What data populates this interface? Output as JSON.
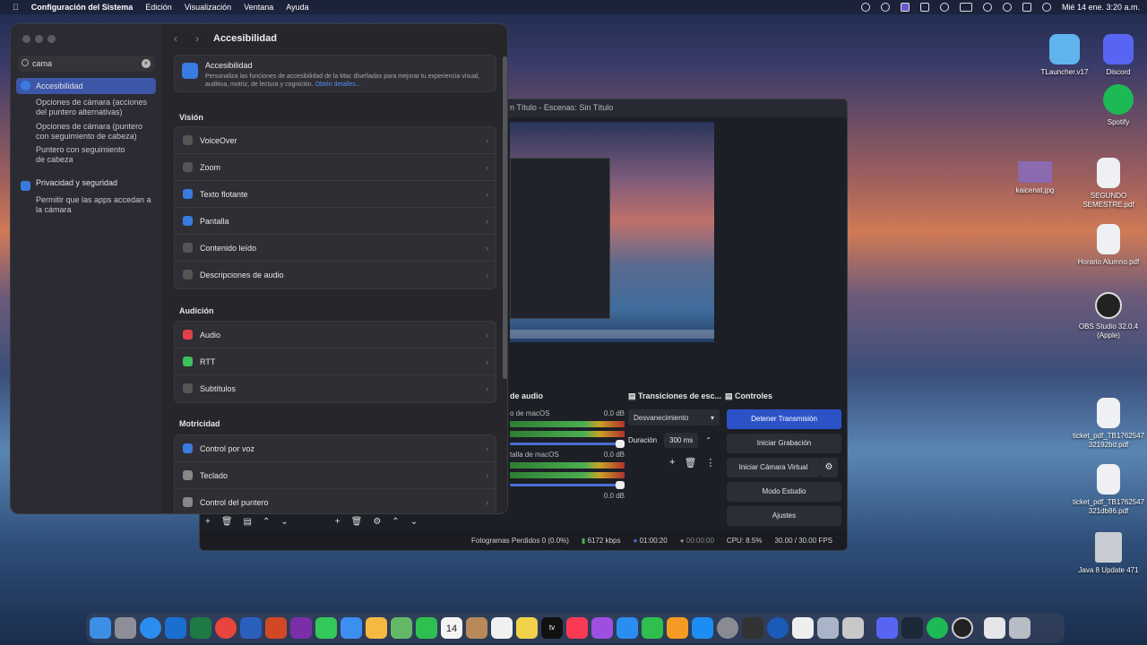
{
  "menubar": {
    "apple": "",
    "app": "Configuración del Sistema",
    "items": [
      "Edición",
      "Visualización",
      "Ventana",
      "Ayuda"
    ],
    "clock": "Mié 14 ene.  3:20 a.m."
  },
  "obs": {
    "title": "n Título - Escenas: Sin Título",
    "audio_header": "de audio",
    "audio_tracks": [
      {
        "name": "o de macOS",
        "db": "0.0 dB"
      },
      {
        "name": "talla de macOS",
        "db": "0.0 dB"
      }
    ],
    "last_db": "0.0 dB",
    "transitions_header": "Transiciones de esc...",
    "transition_value": "Desvanecimiento",
    "duration_label": "Duración",
    "duration_value": "300 ms",
    "controls_header": "Controles",
    "buttons": [
      "Detener Transmisión",
      "Iniciar Grabación",
      "Iniciar Cámara Virtual",
      "Modo Estudio",
      "Ajustes"
    ],
    "status": {
      "dropped": "Fotogramas Perdidos 0 (0.0%)",
      "bitrate": "6172 kbps",
      "stream_time": "01:00:20",
      "rec_time": "00:00:00",
      "cpu": "CPU: 8.5%",
      "fps": "30.00 / 30.00 FPS"
    }
  },
  "settings": {
    "search_value": "cama",
    "sidebar": {
      "acc": "Accesibilidad",
      "acc_subs": [
        "Opciones de cámara (acciones del puntero alternativas)",
        "Opciones de cámara (puntero con seguimiento de cabeza)",
        "Puntero con seguimiento de cabeza"
      ],
      "priv": "Privacidad y seguridad",
      "priv_subs": [
        "Permitir que las apps accedan a la cámara"
      ]
    },
    "title": "Accesibilidad",
    "intro_title": "Accesibilidad",
    "intro_text": "Personaliza las funciones de accesibilidad de la Mac diseñadas para mejorar tu experiencia visual, auditiva, motriz, de lectura y cognición.",
    "intro_link": "Obtén detalles...",
    "vision_header": "Visión",
    "vision": [
      "VoiceOver",
      "Zoom",
      "Texto flotante",
      "Pantalla",
      "Contenido leído",
      "Descripciones de audio"
    ],
    "hearing_header": "Audición",
    "hearing": [
      "Audio",
      "RTT",
      "Subtítulos"
    ],
    "motor_header": "Motricidad",
    "motor": [
      "Control por voz",
      "Teclado",
      "Control del puntero"
    ]
  },
  "desktop": [
    {
      "label": "TLauncher.v17"
    },
    {
      "label": "Discord"
    },
    {
      "label": "Spotify"
    },
    {
      "label": "kaicenat.jpg"
    },
    {
      "label": "SEGUNDO SEMESTRE.pdf"
    },
    {
      "label": "Horario Alumno.pdf"
    },
    {
      "label": "OBS Studio 32.0.4 (Apple)"
    },
    {
      "label": "ticket_pdf_TB176254732192bd.pdf"
    },
    {
      "label": "ticket_pdf_TB1762547321db86.pdf"
    },
    {
      "label": "Java 8 Update 471"
    }
  ],
  "dock": {
    "calendar_day": "14",
    "apple_tv": "tv"
  }
}
